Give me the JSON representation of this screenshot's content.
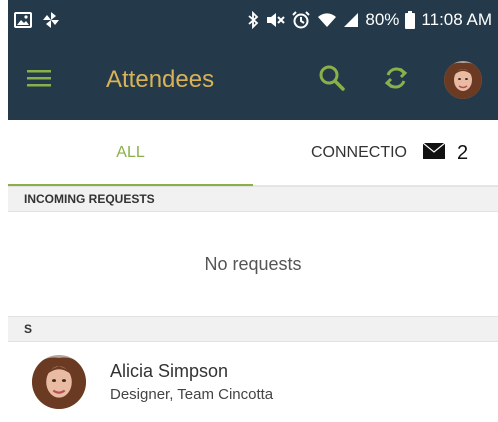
{
  "status_bar": {
    "left_icons": [
      "image-icon",
      "pinwheel-icon"
    ],
    "right_icons": [
      "bluetooth-icon",
      "mute-icon",
      "alarm-icon",
      "wifi-icon",
      "signal-icon",
      "battery-icon"
    ],
    "battery": "80%",
    "time": "11:08 AM"
  },
  "app_bar": {
    "title": "Attendees",
    "menu_icon": "hamburger-menu-icon",
    "actions": [
      "search-icon",
      "refresh-icon",
      "avatar"
    ],
    "background_color": "#243a4a",
    "title_color": "#d9b257",
    "accent_color": "#8ab04a"
  },
  "tabs": [
    {
      "label": "ALL",
      "selected": true
    },
    {
      "label": "CONNECTIO",
      "selected": false,
      "badge_icon": "envelope-icon",
      "badge_count": "2"
    }
  ],
  "sections": [
    {
      "header": "INCOMING REQUESTS",
      "empty_text": "No requests"
    },
    {
      "header": "S"
    }
  ],
  "attendees": [
    {
      "name": "Alicia Simpson",
      "role": "Designer, Team Cincotta"
    }
  ]
}
